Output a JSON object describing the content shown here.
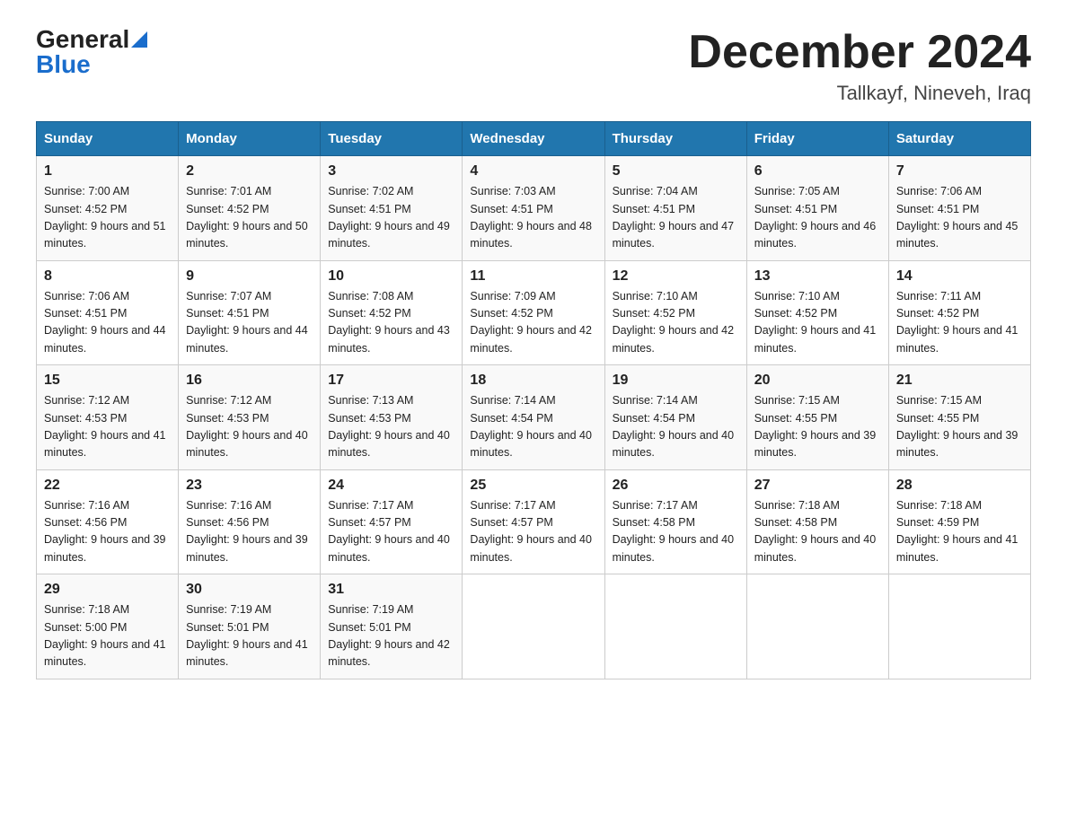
{
  "header": {
    "logo_general": "General",
    "logo_blue": "Blue",
    "month": "December 2024",
    "location": "Tallkayf, Nineveh, Iraq"
  },
  "days_of_week": [
    "Sunday",
    "Monday",
    "Tuesday",
    "Wednesday",
    "Thursday",
    "Friday",
    "Saturday"
  ],
  "weeks": [
    [
      {
        "day": "1",
        "sunrise": "7:00 AM",
        "sunset": "4:52 PM",
        "daylight": "9 hours and 51 minutes."
      },
      {
        "day": "2",
        "sunrise": "7:01 AM",
        "sunset": "4:52 PM",
        "daylight": "9 hours and 50 minutes."
      },
      {
        "day": "3",
        "sunrise": "7:02 AM",
        "sunset": "4:51 PM",
        "daylight": "9 hours and 49 minutes."
      },
      {
        "day": "4",
        "sunrise": "7:03 AM",
        "sunset": "4:51 PM",
        "daylight": "9 hours and 48 minutes."
      },
      {
        "day": "5",
        "sunrise": "7:04 AM",
        "sunset": "4:51 PM",
        "daylight": "9 hours and 47 minutes."
      },
      {
        "day": "6",
        "sunrise": "7:05 AM",
        "sunset": "4:51 PM",
        "daylight": "9 hours and 46 minutes."
      },
      {
        "day": "7",
        "sunrise": "7:06 AM",
        "sunset": "4:51 PM",
        "daylight": "9 hours and 45 minutes."
      }
    ],
    [
      {
        "day": "8",
        "sunrise": "7:06 AM",
        "sunset": "4:51 PM",
        "daylight": "9 hours and 44 minutes."
      },
      {
        "day": "9",
        "sunrise": "7:07 AM",
        "sunset": "4:51 PM",
        "daylight": "9 hours and 44 minutes."
      },
      {
        "day": "10",
        "sunrise": "7:08 AM",
        "sunset": "4:52 PM",
        "daylight": "9 hours and 43 minutes."
      },
      {
        "day": "11",
        "sunrise": "7:09 AM",
        "sunset": "4:52 PM",
        "daylight": "9 hours and 42 minutes."
      },
      {
        "day": "12",
        "sunrise": "7:10 AM",
        "sunset": "4:52 PM",
        "daylight": "9 hours and 42 minutes."
      },
      {
        "day": "13",
        "sunrise": "7:10 AM",
        "sunset": "4:52 PM",
        "daylight": "9 hours and 41 minutes."
      },
      {
        "day": "14",
        "sunrise": "7:11 AM",
        "sunset": "4:52 PM",
        "daylight": "9 hours and 41 minutes."
      }
    ],
    [
      {
        "day": "15",
        "sunrise": "7:12 AM",
        "sunset": "4:53 PM",
        "daylight": "9 hours and 41 minutes."
      },
      {
        "day": "16",
        "sunrise": "7:12 AM",
        "sunset": "4:53 PM",
        "daylight": "9 hours and 40 minutes."
      },
      {
        "day": "17",
        "sunrise": "7:13 AM",
        "sunset": "4:53 PM",
        "daylight": "9 hours and 40 minutes."
      },
      {
        "day": "18",
        "sunrise": "7:14 AM",
        "sunset": "4:54 PM",
        "daylight": "9 hours and 40 minutes."
      },
      {
        "day": "19",
        "sunrise": "7:14 AM",
        "sunset": "4:54 PM",
        "daylight": "9 hours and 40 minutes."
      },
      {
        "day": "20",
        "sunrise": "7:15 AM",
        "sunset": "4:55 PM",
        "daylight": "9 hours and 39 minutes."
      },
      {
        "day": "21",
        "sunrise": "7:15 AM",
        "sunset": "4:55 PM",
        "daylight": "9 hours and 39 minutes."
      }
    ],
    [
      {
        "day": "22",
        "sunrise": "7:16 AM",
        "sunset": "4:56 PM",
        "daylight": "9 hours and 39 minutes."
      },
      {
        "day": "23",
        "sunrise": "7:16 AM",
        "sunset": "4:56 PM",
        "daylight": "9 hours and 39 minutes."
      },
      {
        "day": "24",
        "sunrise": "7:17 AM",
        "sunset": "4:57 PM",
        "daylight": "9 hours and 40 minutes."
      },
      {
        "day": "25",
        "sunrise": "7:17 AM",
        "sunset": "4:57 PM",
        "daylight": "9 hours and 40 minutes."
      },
      {
        "day": "26",
        "sunrise": "7:17 AM",
        "sunset": "4:58 PM",
        "daylight": "9 hours and 40 minutes."
      },
      {
        "day": "27",
        "sunrise": "7:18 AM",
        "sunset": "4:58 PM",
        "daylight": "9 hours and 40 minutes."
      },
      {
        "day": "28",
        "sunrise": "7:18 AM",
        "sunset": "4:59 PM",
        "daylight": "9 hours and 41 minutes."
      }
    ],
    [
      {
        "day": "29",
        "sunrise": "7:18 AM",
        "sunset": "5:00 PM",
        "daylight": "9 hours and 41 minutes."
      },
      {
        "day": "30",
        "sunrise": "7:19 AM",
        "sunset": "5:01 PM",
        "daylight": "9 hours and 41 minutes."
      },
      {
        "day": "31",
        "sunrise": "7:19 AM",
        "sunset": "5:01 PM",
        "daylight": "9 hours and 42 minutes."
      },
      null,
      null,
      null,
      null
    ]
  ]
}
